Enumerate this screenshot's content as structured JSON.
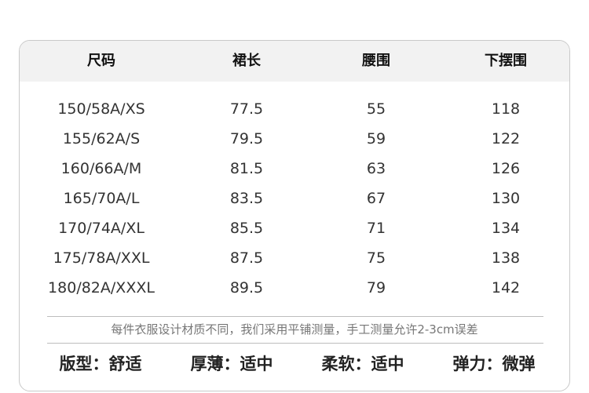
{
  "table": {
    "headers": [
      "尺码",
      "裙长",
      "腰围",
      "下摆围"
    ],
    "rows": [
      [
        "150/58A/XS",
        "77.5",
        "55",
        "118"
      ],
      [
        "155/62A/S",
        "79.5",
        "59",
        "122"
      ],
      [
        "160/66A/M",
        "81.5",
        "63",
        "126"
      ],
      [
        "165/70A/L",
        "83.5",
        "67",
        "130"
      ],
      [
        "170/74A/XL",
        "85.5",
        "71",
        "134"
      ],
      [
        "175/78A/XXL",
        "87.5",
        "75",
        "138"
      ],
      [
        "180/82A/XXXL",
        "89.5",
        "79",
        "142"
      ]
    ]
  },
  "note": "每件衣服设计材质不同，我们采用平铺测量，手工测量允许2-3cm误差",
  "attributes": [
    "版型：舒适",
    "厚薄：适中",
    "柔软：适中",
    "弹力：微弹"
  ],
  "colors": {
    "header_bg": "#f2f2f2",
    "border": "#c9c9c9",
    "note_text": "#777777"
  }
}
